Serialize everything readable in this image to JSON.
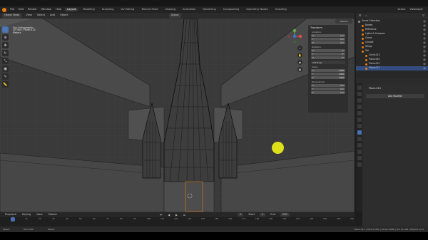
{
  "menubar": {
    "menus": [
      "File",
      "Edit",
      "Render",
      "Window",
      "Help"
    ],
    "workspaces": [
      "Layout",
      "Modeling",
      "Sculpting",
      "UV Editing",
      "Texture Paint",
      "Shading",
      "Animation",
      "Rendering",
      "Compositing",
      "Geometry Nodes",
      "Scripting"
    ],
    "active_workspace": "Layout",
    "scene": "Scene",
    "view_layer": "ViewLayer"
  },
  "viewport_header": {
    "mode": "Object Mode",
    "menus": [
      "View",
      "Select",
      "Add",
      "Object"
    ],
    "orientation": "Global",
    "options": "Options"
  },
  "viewport_info": {
    "line1": "Top Orthographic",
    "line2": "(0) Tail | Plane.013",
    "line3": "Meters"
  },
  "npanel": {
    "title": "Transform",
    "location_label": "Location:",
    "location": [
      {
        "axis": "X",
        "value": "0 m"
      },
      {
        "axis": "Y",
        "value": "0 m"
      },
      {
        "axis": "Z",
        "value": "0 m"
      }
    ],
    "rotation_label": "Rotation:",
    "rotation": [
      {
        "axis": "X",
        "value": "0°"
      },
      {
        "axis": "Y",
        "value": "0°"
      },
      {
        "axis": "Z",
        "value": "0°"
      }
    ],
    "rotation_mode": "XYZ Euler",
    "scale_label": "Scale:",
    "scale": [
      {
        "axis": "X",
        "value": "1.000"
      },
      {
        "axis": "Y",
        "value": "1.000"
      },
      {
        "axis": "Z",
        "value": "1.000"
      }
    ],
    "dimensions_label": "Dimensions:",
    "dimensions": [
      {
        "axis": "X",
        "value": "0 m"
      },
      {
        "axis": "Y",
        "value": "0 m"
      },
      {
        "axis": "Z",
        "value": "0 m"
      }
    ]
  },
  "timeline": {
    "menus": [
      "Playback",
      "Keying",
      "View",
      "Marker"
    ],
    "ticks": [
      "0",
      "10",
      "20",
      "30",
      "40",
      "50",
      "60",
      "70",
      "80",
      "90",
      "100",
      "110",
      "120",
      "130",
      "140",
      "150",
      "160",
      "170",
      "180",
      "190",
      "200",
      "210",
      "220",
      "230",
      "240",
      "250"
    ],
    "current_frame": "1",
    "start_label": "Start",
    "start": "1",
    "end_label": "End",
    "end": "250"
  },
  "statusbar": {
    "select": "Select",
    "pan": "Pan View",
    "context": "Object",
    "stats": "Plane.013 | Verts 6,282 | Faces 5,688 | Tris 11,188 | Objects 1/11"
  },
  "outliner": {
    "header": "Scene Collection",
    "items": [
      {
        "label": "Scene Collection",
        "indent": 0,
        "color": "#9a9a9a"
      },
      {
        "label": "Bodies",
        "indent": 1,
        "color": "#e87d0d"
      },
      {
        "label": "Reference",
        "indent": 1,
        "color": "#e87d0d"
      },
      {
        "label": "Lights & Cameras",
        "indent": 1,
        "color": "#e87d0d"
      },
      {
        "label": "Cones",
        "indent": 1,
        "color": "#e87d0d"
      },
      {
        "label": "Cockpit",
        "indent": 1,
        "color": "#e87d0d"
      },
      {
        "label": "Wings",
        "indent": 1,
        "color": "#e87d0d"
      },
      {
        "label": "Tail",
        "indent": 1,
        "color": "#e87d0d"
      },
      {
        "label": "Circle.013",
        "indent": 2,
        "color": "#e87d0d"
      },
      {
        "label": "Plane.005",
        "indent": 2,
        "color": "#e87d0d"
      },
      {
        "label": "Plane.012",
        "indent": 2,
        "color": "#e87d0d"
      },
      {
        "label": "Plane.013",
        "indent": 2,
        "color": "#e87d0d",
        "selected": true
      }
    ]
  },
  "properties": {
    "object_name": "Plane.013",
    "add_modifier": "Add Modifier"
  },
  "colors": {
    "accent": "#4772b3",
    "highlight": "#e6e817",
    "object_orange": "#e87d0d"
  }
}
